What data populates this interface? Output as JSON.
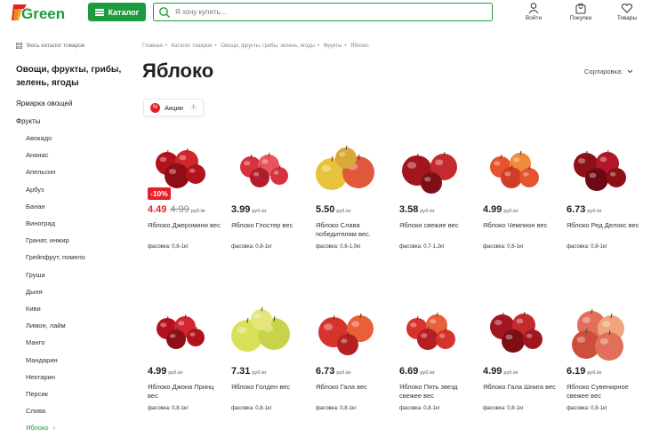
{
  "header": {
    "logo": "Green",
    "catalog_label": "Каталог",
    "search_placeholder": "Я хочу купить...",
    "login_label": "Войти",
    "purchases_label": "Покупки",
    "goods_label": "Товары",
    "accent_color": "#1d9c3f"
  },
  "breadcrumbs": [
    "Главная",
    "Каталог товаров",
    "Овощи, фрукты, грибы, зелень, ягоды",
    "Фрукты",
    "Яблоко"
  ],
  "sidebar": {
    "all_catalog": "Весь каталог товаров",
    "section_title": "Овощи, фрукты, грибы, зелень, ягоды",
    "fair": "Ярмарка овощей",
    "fruits": "Фрукты",
    "items": [
      "Авокадо",
      "Ананас",
      "Апельсин",
      "Арбуз",
      "Банан",
      "Виноград",
      "Гранат, инжир",
      "Грейпфрут, помело",
      "Груша",
      "Дыня",
      "Киви",
      "Лимон, лайм",
      "Манго",
      "Мандарин",
      "Нектарин",
      "Персик",
      "Слива",
      "Яблоко"
    ]
  },
  "page": {
    "title": "Яблоко",
    "sort_label": "Сортировка:",
    "promo_chip": "Акции",
    "promo_count": "1",
    "promo_icon": "%"
  },
  "products": [
    {
      "price": "4.49",
      "old_price": "4.99",
      "unit": "руб./кг",
      "discount": "-10%",
      "name": "Яблоко Джеромини вес",
      "pack": "фасовка: 0,8-1кг",
      "apple": "red-cluster"
    },
    {
      "price": "3.99",
      "unit": "руб./кг",
      "name": "Яблоко Глостер вес",
      "pack": "фасовка: 0,8-1кг",
      "apple": "red-small"
    },
    {
      "price": "5.50",
      "unit": "руб./кг",
      "name": "Яблоко Слава победителям вес.",
      "pack": "фасовка: 0,8-1,0кг",
      "apple": "yellow-red"
    },
    {
      "price": "3.58",
      "unit": "руб./кг",
      "name": "Яблоки свежие вес",
      "pack": "фасовка: 0,7-1,2кг",
      "apple": "dark-red"
    },
    {
      "price": "4.99",
      "unit": "руб./кг",
      "name": "Яблоко Чемпион вес",
      "pack": "фасовка: 0,8-1кг",
      "apple": "orange-red"
    },
    {
      "price": "6.73",
      "unit": "руб./кг",
      "name": "Яблоко Ред Делокс вес",
      "pack": "фасовка: 0,8-1кг",
      "apple": "deep-red"
    },
    {
      "price": "4.99",
      "unit": "руб./кг",
      "name": "Яблоко Джона Принц вес",
      "pack": "фасовка: 0,8-1кг",
      "apple": "red-cluster"
    },
    {
      "price": "7.31",
      "unit": "руб./кг",
      "name": "Яблоко Голден вес",
      "pack": "фасовка: 0,8-1кг",
      "apple": "golden"
    },
    {
      "price": "6.73",
      "unit": "руб./кг",
      "name": "Яблоко Гала вес",
      "pack": "фасовка: 0,8-1кг",
      "apple": "gala"
    },
    {
      "price": "6.69",
      "unit": "руб./кг",
      "name": "Яблоко Пять звезд свежее вес",
      "pack": "фасовка: 0,8-1кг",
      "apple": "gala"
    },
    {
      "price": "4.99",
      "unit": "руб./кг",
      "name": "Яблоко Гала Шнига вес",
      "pack": "фасовка: 0,8-1кг",
      "apple": "dark-red"
    },
    {
      "price": "6.19",
      "unit": "руб./кг",
      "name": "Яблоко Сувенирное свежее вес",
      "pack": "фасовка: 0,8-1кг",
      "apple": "pale-red"
    }
  ]
}
